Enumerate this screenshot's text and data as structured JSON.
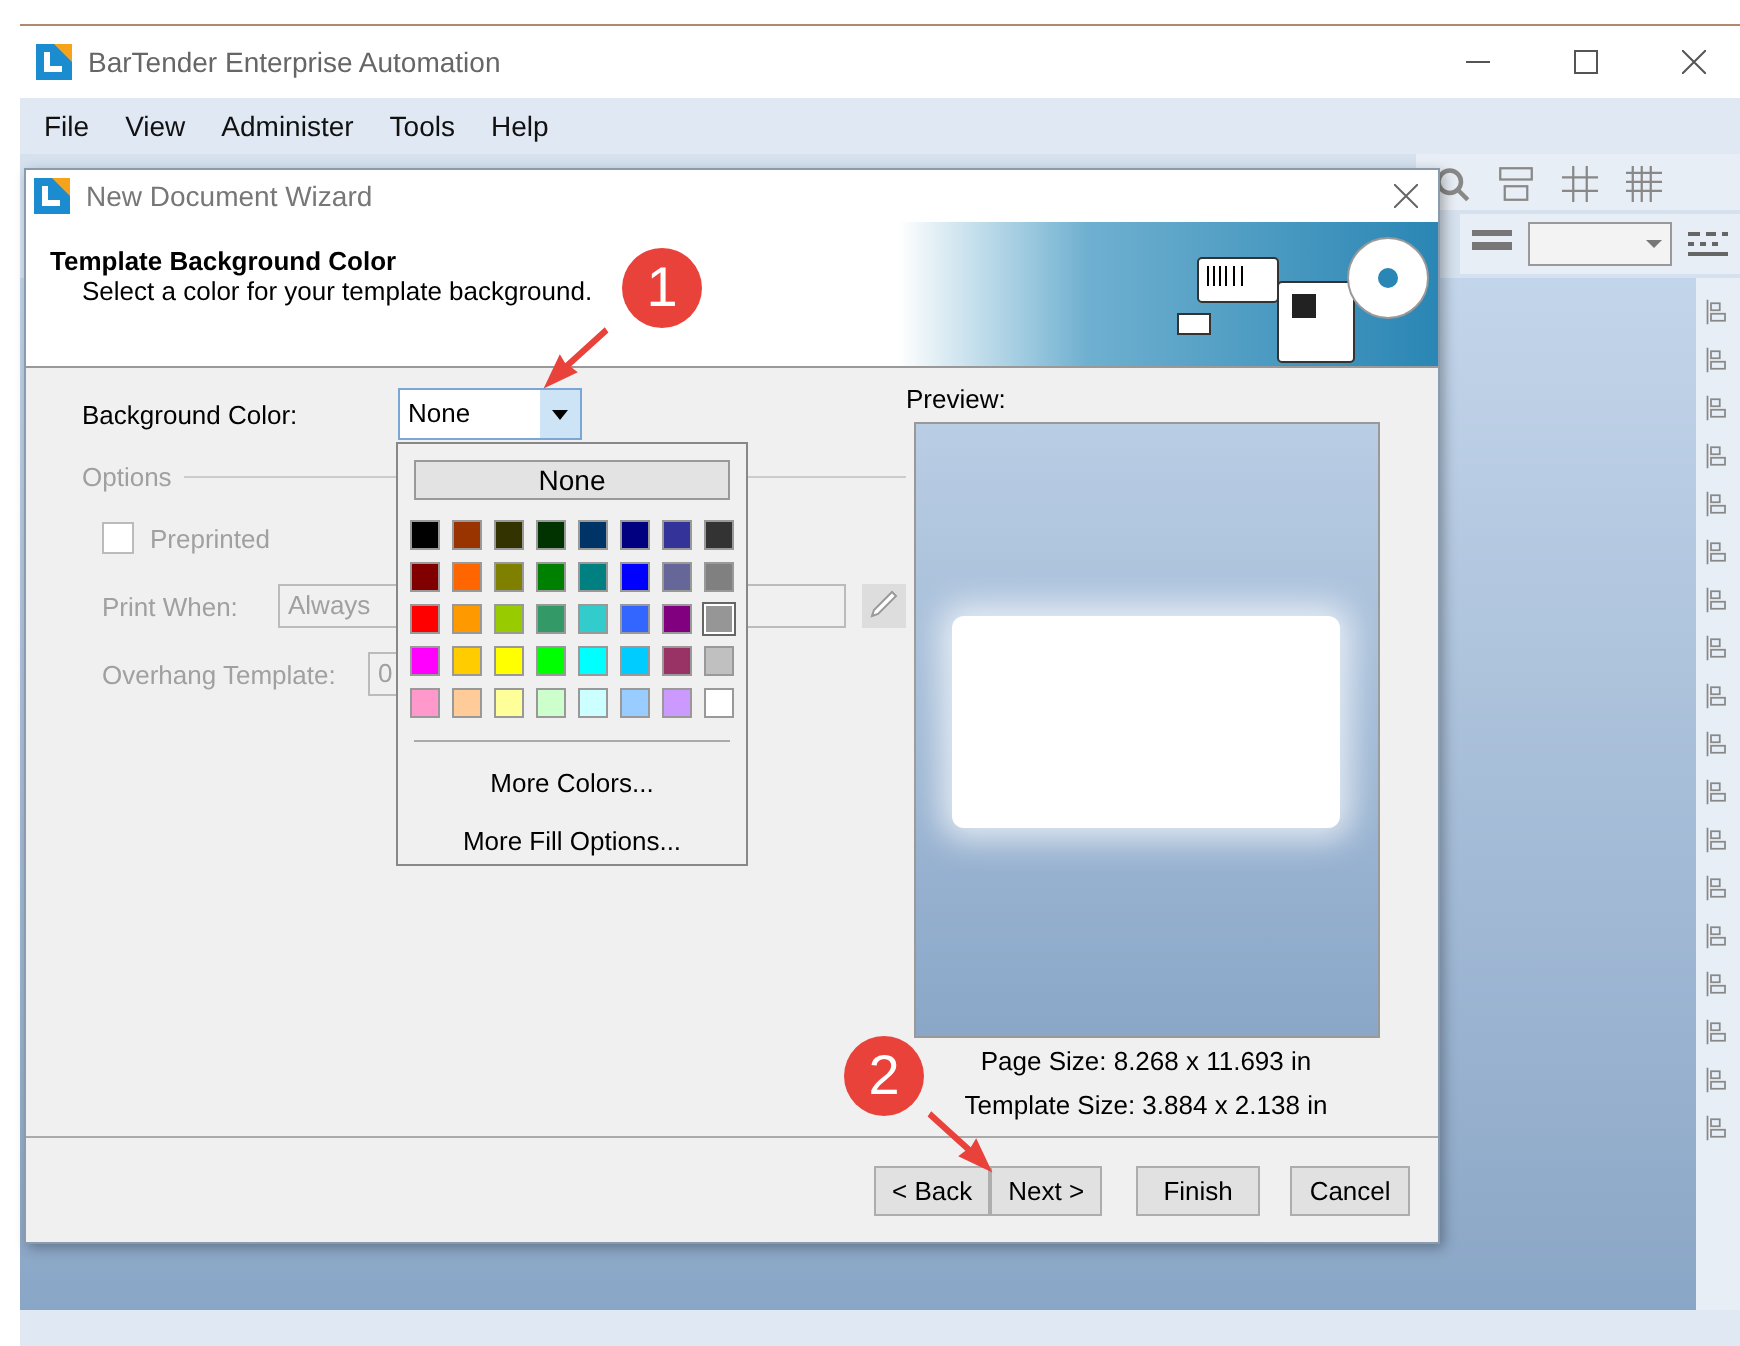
{
  "app_window": {
    "title": "BarTender Enterprise Automation"
  },
  "menu_bar": {
    "items": [
      "File",
      "View",
      "Administer",
      "Tools",
      "Help"
    ]
  },
  "dialog": {
    "title": "New Document Wizard",
    "heading": "Template Background Color",
    "subheading": "Select a color for your template background.",
    "background_color": {
      "label": "Background Color:",
      "value": "None",
      "open": true
    },
    "options": {
      "legend": "Options",
      "disabled": true,
      "preprinted": {
        "label": "Preprinted",
        "checked": false
      },
      "print_when": {
        "label": "Print When:",
        "value": "Always"
      },
      "overhang": {
        "label": "Overhang Template:",
        "value": "0"
      }
    },
    "palette": {
      "none_label": "None",
      "swatches": [
        {
          "color": "#000000",
          "selected": false
        },
        {
          "color": "#993300",
          "selected": false
        },
        {
          "color": "#333300",
          "selected": false
        },
        {
          "color": "#003300",
          "selected": false
        },
        {
          "color": "#003366",
          "selected": false
        },
        {
          "color": "#000080",
          "selected": false
        },
        {
          "color": "#333399",
          "selected": false
        },
        {
          "color": "#333333",
          "selected": false
        },
        {
          "color": "#800000",
          "selected": false
        },
        {
          "color": "#ff6600",
          "selected": false
        },
        {
          "color": "#808000",
          "selected": false
        },
        {
          "color": "#008000",
          "selected": false
        },
        {
          "color": "#008080",
          "selected": false
        },
        {
          "color": "#0000ff",
          "selected": false
        },
        {
          "color": "#666699",
          "selected": false
        },
        {
          "color": "#808080",
          "selected": false
        },
        {
          "color": "#ff0000",
          "selected": false
        },
        {
          "color": "#ff9900",
          "selected": false
        },
        {
          "color": "#99cc00",
          "selected": false
        },
        {
          "color": "#339966",
          "selected": false
        },
        {
          "color": "#33cccc",
          "selected": false
        },
        {
          "color": "#3366ff",
          "selected": false
        },
        {
          "color": "#800080",
          "selected": false
        },
        {
          "color": "#969696",
          "selected": true
        },
        {
          "color": "#ff00ff",
          "selected": false
        },
        {
          "color": "#ffcc00",
          "selected": false
        },
        {
          "color": "#ffff00",
          "selected": false
        },
        {
          "color": "#00ff00",
          "selected": false
        },
        {
          "color": "#00ffff",
          "selected": false
        },
        {
          "color": "#00ccff",
          "selected": false
        },
        {
          "color": "#993366",
          "selected": false
        },
        {
          "color": "#c0c0c0",
          "selected": false
        },
        {
          "color": "#ff99cc",
          "selected": false
        },
        {
          "color": "#ffcc99",
          "selected": false
        },
        {
          "color": "#ffff99",
          "selected": false
        },
        {
          "color": "#ccffcc",
          "selected": false
        },
        {
          "color": "#ccffff",
          "selected": false
        },
        {
          "color": "#99ccff",
          "selected": false
        },
        {
          "color": "#cc99ff",
          "selected": false
        },
        {
          "color": "#ffffff",
          "selected": false
        }
      ],
      "links": [
        "More Colors...",
        "More Fill Options..."
      ]
    },
    "preview": {
      "label": "Preview:",
      "page_size": "Page Size:  8.268 x 11.693 in",
      "template_size": "Template Size:  3.884 x 2.138 in"
    },
    "buttons": [
      {
        "label": "< Back",
        "disabled": false
      },
      {
        "label": "Next  >",
        "disabled": false
      },
      {
        "label": "Finish",
        "disabled": false
      },
      {
        "label": "Cancel",
        "disabled": false
      }
    ]
  },
  "annotations": [
    {
      "label": "1"
    },
    {
      "label": "2"
    }
  ]
}
